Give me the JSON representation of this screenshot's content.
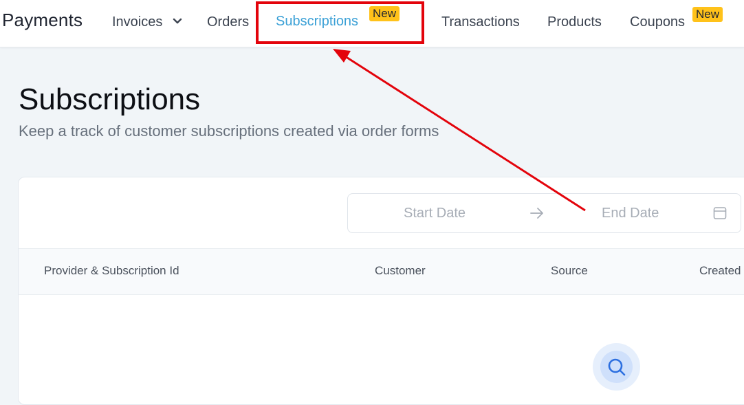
{
  "nav": {
    "brand": "Payments",
    "items": [
      {
        "label": "Invoices"
      },
      {
        "label": "Orders"
      },
      {
        "label": "Subscriptions",
        "badge": "New"
      },
      {
        "label": "Transactions"
      },
      {
        "label": "Products"
      },
      {
        "label": "Coupons",
        "badge": "New"
      }
    ]
  },
  "page": {
    "title": "Subscriptions",
    "subtitle": "Keep a track of customer subscriptions created via order forms"
  },
  "filters": {
    "start_placeholder": "Start Date",
    "end_placeholder": "End Date"
  },
  "table": {
    "columns": [
      "Provider & Subscription Id",
      "Customer",
      "Source",
      "Created"
    ]
  },
  "colors": {
    "active_nav": "#3aa0d6",
    "badge": "#ffc21a",
    "annotation_red": "#e3030b"
  },
  "icons": [
    "chevron-down-icon",
    "arrow-right-icon",
    "calendar-icon",
    "search-icon"
  ]
}
